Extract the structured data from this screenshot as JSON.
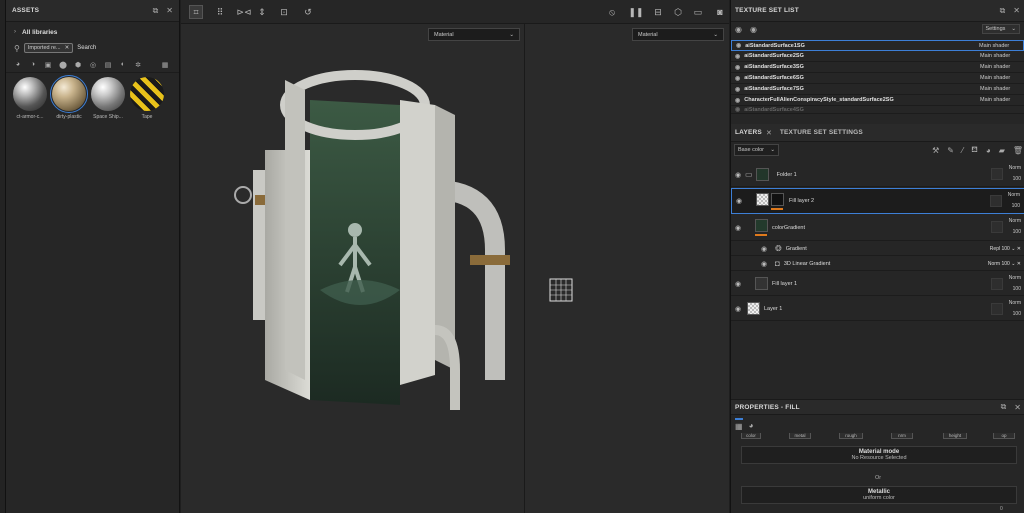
{
  "assets": {
    "title": "ASSETS",
    "library": "All libraries",
    "filter_chip": "Imported re...",
    "search_label": "Search",
    "items": [
      {
        "label": "ct-armor-c..."
      },
      {
        "label": "dirty-plastic"
      },
      {
        "label": "Space Ship..."
      },
      {
        "label": "Tape"
      }
    ]
  },
  "viewport": {
    "left_mode": "Material",
    "right_mode": "Material"
  },
  "texture_set_list": {
    "title": "TEXTURE SET LIST",
    "settings": "Settings",
    "rows": [
      {
        "name": "aiStandardSurface1SG",
        "shader": "Main shader"
      },
      {
        "name": "aiStandardSurface2SG",
        "shader": "Main shader"
      },
      {
        "name": "aiStandardSurface3SG",
        "shader": "Main shader"
      },
      {
        "name": "aiStandardSurface6SG",
        "shader": "Main shader"
      },
      {
        "name": "aiStandardSurface7SG",
        "shader": "Main shader"
      },
      {
        "name": "CharacterFullAlienConspiracyStyle_standardSurface2SG",
        "shader": "Main shader"
      },
      {
        "name": "aiStandardSurface4SG",
        "shader": ""
      }
    ]
  },
  "layers": {
    "tab_layers": "LAYERS",
    "tab_texture_set_settings": "TEXTURE SET SETTINGS",
    "channel": "Base color",
    "rows": [
      {
        "name": "Folder 1",
        "blend": "Norm",
        "opacity": "100"
      },
      {
        "name": "Fill layer 2",
        "blend": "Norm",
        "opacity": "100"
      },
      {
        "name": "colorGradient",
        "blend": "Norm",
        "opacity": "100"
      },
      {
        "name": "Gradient",
        "blend": "Repl",
        "opacity": "100"
      },
      {
        "name": "3D Linear Gradient",
        "blend": "Norm",
        "opacity": "100"
      },
      {
        "name": "Fill layer 1",
        "blend": "Norm",
        "opacity": "100"
      },
      {
        "name": "Layer 1",
        "blend": "Norm",
        "opacity": "100"
      }
    ]
  },
  "properties": {
    "title": "PROPERTIES - FILL",
    "channels": [
      "color",
      "metal",
      "rough",
      "nrm",
      "height",
      "op"
    ],
    "material_mode_title": "Material mode",
    "material_mode_value": "No Resource Selected",
    "or": "Or",
    "metallic_title": "Metallic",
    "metallic_value": "uniform color",
    "metallic_number": "0"
  },
  "colors": {
    "accent": "#3d7fd6",
    "orange": "#e07a1c"
  }
}
